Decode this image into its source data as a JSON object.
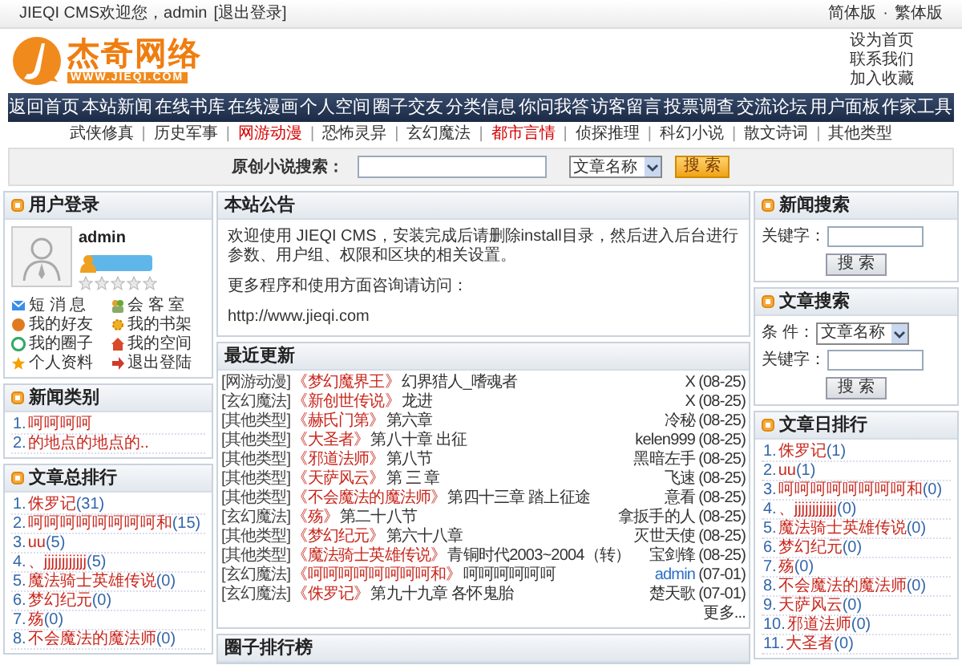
{
  "top_bar": {
    "welcome": "JIEQI CMS欢迎您，admin",
    "logout": "[退出登录]",
    "languages": [
      "简体版",
      "繁体版"
    ],
    "language_separator": "·"
  },
  "logo": {
    "title": "杰奇网络",
    "url": "WWW.JIEQI.COM"
  },
  "header_links": [
    "设为首页",
    "联系我们",
    "加入收藏"
  ],
  "nav": [
    "返回首页",
    "本站新闻",
    "在线书库",
    "在线漫画",
    "个人空间",
    "圈子交友",
    "分类信息",
    "你问我答",
    "访客留言",
    "投票调查",
    "交流论坛",
    "用户面板",
    "作家工具"
  ],
  "categories": [
    {
      "label": "武侠修真",
      "highlighted": false
    },
    {
      "label": "历史军事",
      "highlighted": false
    },
    {
      "label": "网游动漫",
      "highlighted": true
    },
    {
      "label": "恐怖灵异",
      "highlighted": false
    },
    {
      "label": "玄幻魔法",
      "highlighted": false
    },
    {
      "label": "都市言情",
      "highlighted": true
    },
    {
      "label": "侦探推理",
      "highlighted": false
    },
    {
      "label": "科幻小说",
      "highlighted": false
    },
    {
      "label": "散文诗词",
      "highlighted": false
    },
    {
      "label": "其他类型",
      "highlighted": false
    }
  ],
  "category_separator": "|",
  "search": {
    "label": "原创小说搜索：",
    "select": "文章名称",
    "button": "搜 索"
  },
  "user_login": {
    "title": "用户登录",
    "username": "admin",
    "stars": 0,
    "links": [
      "短 消 息",
      "会 客 室",
      "我的好友",
      "我的书架",
      "我的圈子",
      "我的空间",
      "个人资料",
      "退出登陆"
    ]
  },
  "news_categories": {
    "title": "新闻类别",
    "items": [
      {
        "number": "1.",
        "title": "呵呵呵呵"
      },
      {
        "number": "2.",
        "title": "的地点的地点的.."
      }
    ]
  },
  "article_total_rank": {
    "title": "文章总排行",
    "items": [
      {
        "number": "1.",
        "title": "侏罗记",
        "count": "(31)"
      },
      {
        "number": "2.",
        "title": "呵呵呵呵呵呵呵呵和",
        "count": "(15)"
      },
      {
        "number": "3.",
        "title": "uu",
        "count": "(5)"
      },
      {
        "number": "4.",
        "title": "、jjjjjjjjjjjj",
        "count": "(5)"
      },
      {
        "number": "5.",
        "title": "魔法骑士英雄传说",
        "count": "(0)"
      },
      {
        "number": "6.",
        "title": "梦幻纪元",
        "count": "(0)"
      },
      {
        "number": "7.",
        "title": "殇",
        "count": "(0)"
      },
      {
        "number": "8.",
        "title": "不会魔法的魔法师",
        "count": "(0)"
      }
    ]
  },
  "announcement": {
    "title": "本站公告",
    "paragraphs": [
      "欢迎使用 JIEQI CMS，安装完成后请删除install目录，然后进入后台进行参数、用户组、权限和区块的相关设置。",
      "更多程序和使用方面咨询请访问：",
      "http://www.jieqi.com"
    ]
  },
  "recent_updates": {
    "title": "最近更新",
    "rows": [
      {
        "category": "[网游动漫]",
        "title": "《梦幻魔界王》",
        "chapter": "幻界猎人_嗜魂者",
        "author": "X",
        "date": "(08-25)",
        "author_linked": false
      },
      {
        "category": "[玄幻魔法]",
        "title": "《新创世传说》",
        "chapter": "龙进",
        "author": "X",
        "date": "(08-25)",
        "author_linked": false
      },
      {
        "category": "[其他类型]",
        "title": "《赫氏门第》",
        "chapter": "第六章",
        "author": "冷秘",
        "date": "(08-25)",
        "author_linked": false
      },
      {
        "category": "[其他类型]",
        "title": "《大圣者》",
        "chapter": "第八十章 出征",
        "author": "kelen999",
        "date": "(08-25)",
        "author_linked": false
      },
      {
        "category": "[其他类型]",
        "title": "《邪道法师》",
        "chapter": "第八节",
        "author": "黑暗左手",
        "date": "(08-25)",
        "author_linked": false
      },
      {
        "category": "[其他类型]",
        "title": "《天萨风云》",
        "chapter": "第 三 章",
        "author": "飞速",
        "date": "(08-25)",
        "author_linked": false
      },
      {
        "category": "[其他类型]",
        "title": "《不会魔法的魔法师》",
        "chapter": "第四十三章 踏上征途",
        "author": "意看",
        "date": "(08-25)",
        "author_linked": false
      },
      {
        "category": "[玄幻魔法]",
        "title": "《殇》",
        "chapter": "第二十八节",
        "author": "拿扳手的人",
        "date": "(08-25)",
        "author_linked": false
      },
      {
        "category": "[其他类型]",
        "title": "《梦幻纪元》",
        "chapter": "第六十八章",
        "author": "灭世天使",
        "date": "(08-25)",
        "author_linked": false
      },
      {
        "category": "[其他类型]",
        "title": "《魔法骑士英雄传说》",
        "chapter": "青铜时代2003~2004（转）",
        "author": "宝剑锋",
        "date": "(08-25)",
        "author_linked": false
      },
      {
        "category": "[玄幻魔法]",
        "title": "《呵呵呵呵呵呵呵呵和》",
        "chapter": "呵呵呵呵呵呵",
        "author": "admin",
        "date": "(07-01)",
        "author_linked": true
      },
      {
        "category": "[玄幻魔法]",
        "title": "《侏罗记》",
        "chapter": "第九十九章 各怀鬼胎",
        "author": "楚天歌",
        "date": "(07-01)",
        "author_linked": false
      }
    ],
    "more": "更多..."
  },
  "circle_rank": {
    "title": "圈子排行榜"
  },
  "news_search": {
    "title": "新闻搜索",
    "keyword_label": "关键字：",
    "button": "搜 索"
  },
  "article_search": {
    "title": "文章搜索",
    "condition_label": "条 件：",
    "select": "文章名称",
    "keyword_label": "关键字：",
    "button": "搜 索"
  },
  "article_daily_rank": {
    "title": "文章日排行",
    "items": [
      {
        "number": "1.",
        "title": "侏罗记",
        "count": "(1)"
      },
      {
        "number": "2.",
        "title": "uu",
        "count": "(1)"
      },
      {
        "number": "3.",
        "title": "呵呵呵呵呵呵呵呵和",
        "count": "(0)"
      },
      {
        "number": "4.",
        "title": "、jjjjjjjjjjjj",
        "count": "(0)"
      },
      {
        "number": "5.",
        "title": "魔法骑士英雄传说",
        "count": "(0)"
      },
      {
        "number": "6.",
        "title": "梦幻纪元",
        "count": "(0)"
      },
      {
        "number": "7.",
        "title": "殇",
        "count": "(0)"
      },
      {
        "number": "8.",
        "title": "不会魔法的魔法师",
        "count": "(0)"
      },
      {
        "number": "9.",
        "title": "天萨风云",
        "count": "(0)"
      },
      {
        "number": "10.",
        "title": "邪道法师",
        "count": "(0)"
      },
      {
        "number": "11.",
        "title": "大圣者",
        "count": "(0)"
      }
    ]
  }
}
